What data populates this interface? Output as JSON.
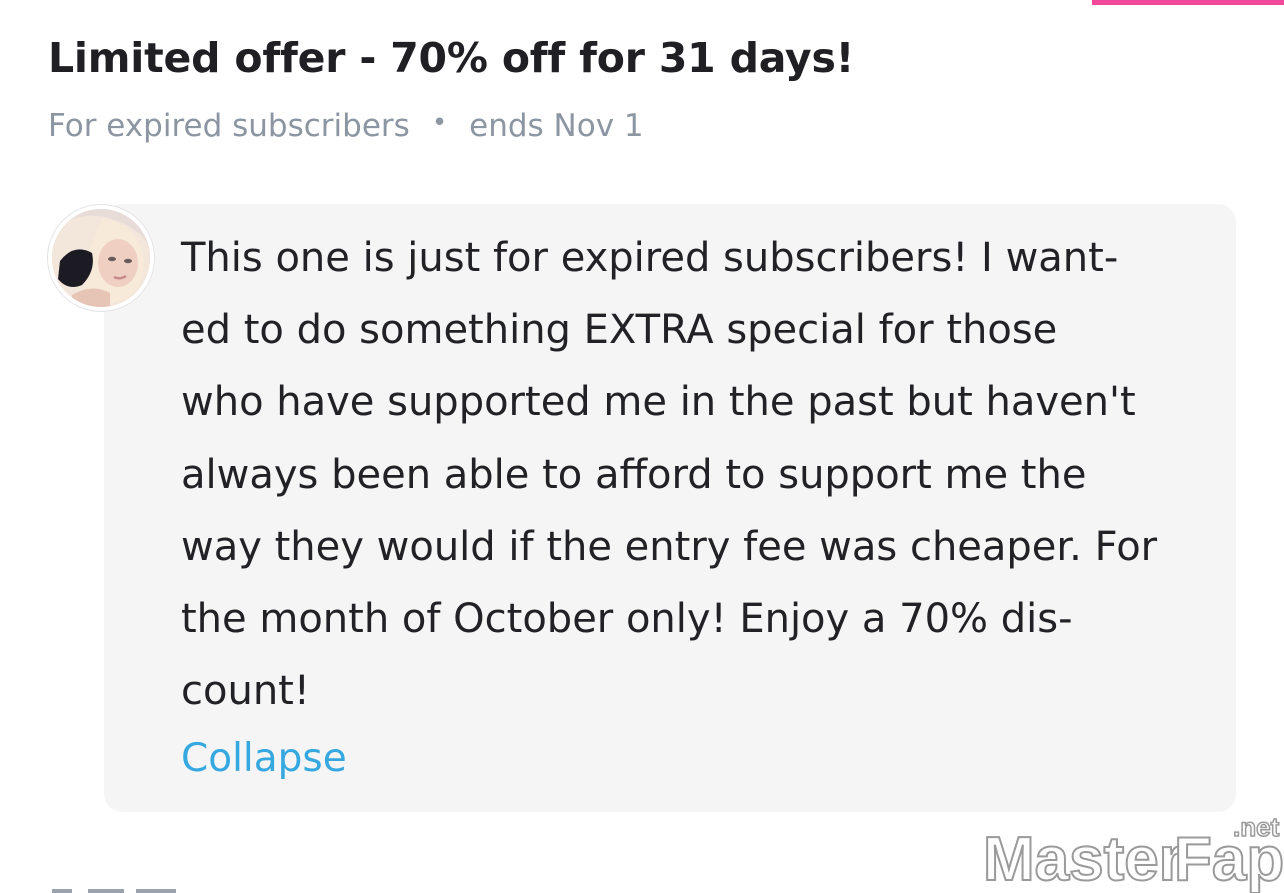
{
  "offer": {
    "title": "Limited offer - 70% off for 31 days!",
    "audience": "For expired subscribers",
    "separator": "•",
    "ends": "ends Nov 1"
  },
  "message": {
    "lines": [
      "This one is just for expired subscribers! I want-",
      "ed to do something EXTRA special for those",
      "who have supported me in the past but haven't",
      "always been able to afford to support me the",
      "way they would if the entry fee was cheaper. For",
      "the month of October only! Enjoy a 70% dis-",
      "count!"
    ],
    "collapse_label": "Collapse"
  },
  "watermark": {
    "brand_part1": "Master",
    "brand_part2": "Fap",
    "suffix": ".net"
  },
  "colors": {
    "accent_pink": "#f2489b",
    "link_blue": "#36a8e0",
    "meta_gray": "#8c96a3",
    "bubble_bg": "#f5f5f6"
  }
}
